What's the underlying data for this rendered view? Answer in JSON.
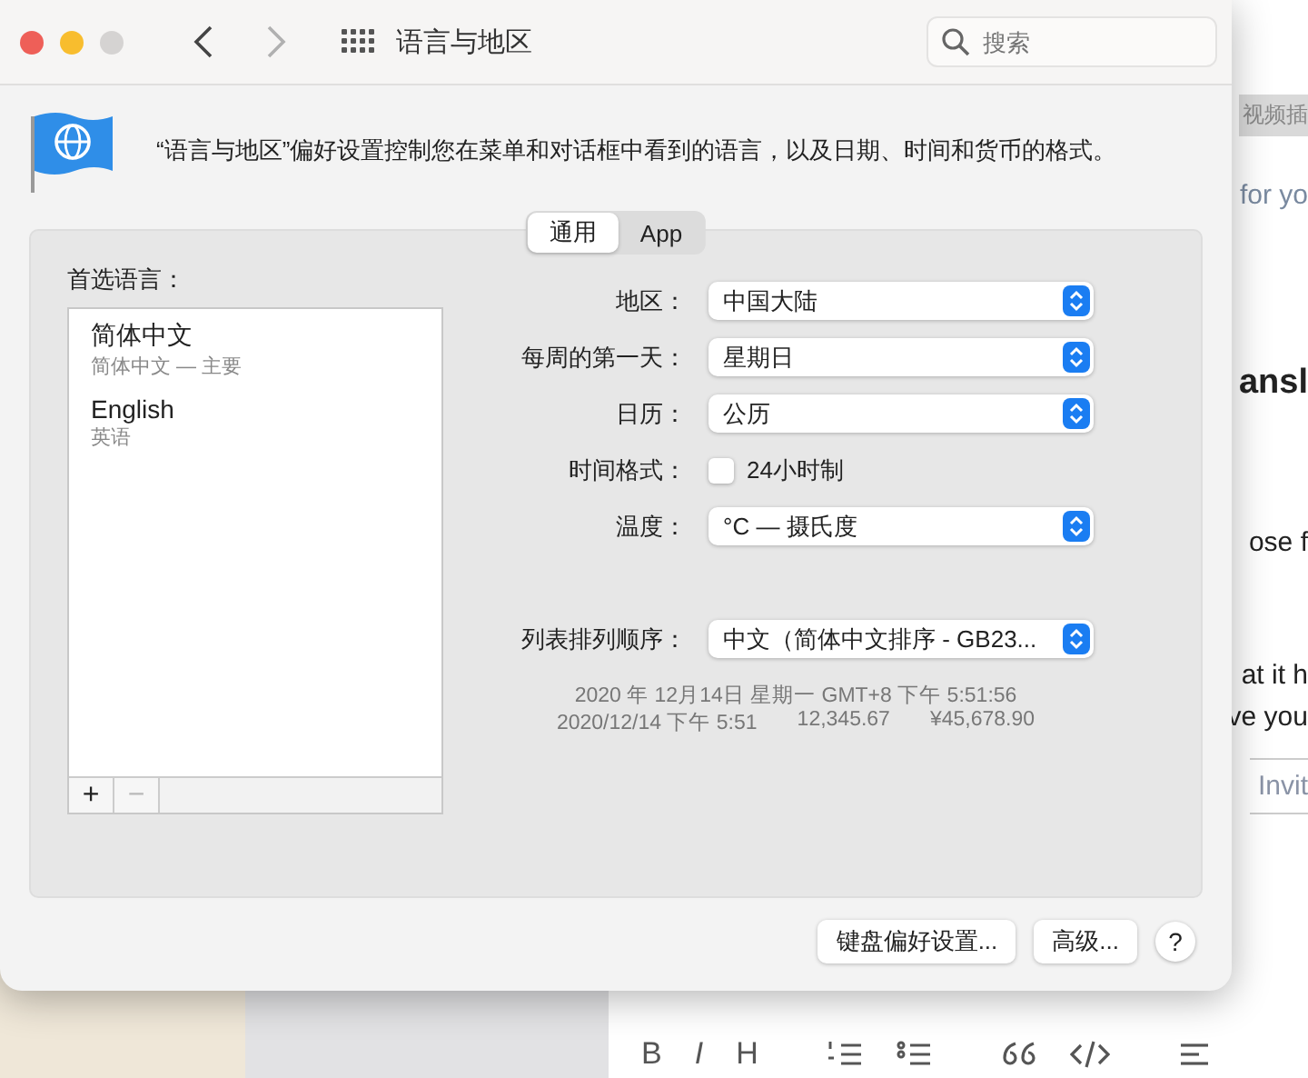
{
  "window": {
    "controls": [
      {
        "color": "#ee5f58"
      },
      {
        "color": "#f8bd2e"
      },
      {
        "color": "#d5d3d2"
      }
    ],
    "nav_buttons": [
      {
        "kind": "back",
        "disabled": false
      },
      {
        "kind": "forward",
        "disabled": true
      }
    ],
    "title": "语言与地区",
    "search": {
      "placeholder": "搜索"
    },
    "description": "“语言与地区”偏好设置控制您在菜单和对话框中看到的语言，以及日期、时间和货币的格式。",
    "tabs": [
      {
        "label": "通用",
        "selected": true
      },
      {
        "label": "App",
        "selected": false
      }
    ],
    "preferred_languages": {
      "label": "首选语言：",
      "items": [
        {
          "name": "简体中文",
          "detail": "简体中文 — 主要"
        },
        {
          "name": "English",
          "detail": "英语"
        }
      ],
      "buttons": [
        {
          "label": "+",
          "disabled": false
        },
        {
          "label": "−",
          "disabled": true
        }
      ]
    },
    "settings": [
      {
        "kind": "popup",
        "label": "地区：",
        "value": "中国大陆"
      },
      {
        "kind": "popup",
        "label": "每周的第一天：",
        "value": "星期日"
      },
      {
        "kind": "popup",
        "label": "日历：",
        "value": "公历"
      },
      {
        "kind": "checkbox",
        "label": "时间格式：",
        "option": "24小时制",
        "checked": false
      },
      {
        "kind": "popup",
        "label": "温度：",
        "value": "°C — 摄氏度"
      },
      {
        "kind": "popup",
        "label": "列表排列顺序：",
        "value": "中文（简体中文排序 - GB23..."
      }
    ],
    "samples": [
      [
        "2020 年 12月14日 星期一 GMT+8 下午 5:51:56"
      ],
      [
        "2020/12/14 下午 5:51",
        "12,345.67",
        "¥45,678.90"
      ]
    ],
    "buttons": [
      {
        "kind": "button",
        "label": "键盘偏好设置..."
      },
      {
        "kind": "button",
        "label": "高级..."
      },
      {
        "kind": "help",
        "label": "?"
      }
    ]
  },
  "background_app": {
    "fragments": [
      {
        "kind": "tab",
        "text": "视频插"
      },
      {
        "kind": "link",
        "text": "for yo"
      },
      {
        "kind": "heading",
        "text": "ansl"
      },
      {
        "kind": "text",
        "text": "ose f"
      },
      {
        "kind": "text",
        "text": "at it h"
      },
      {
        "kind": "text",
        "text": "ve you"
      },
      {
        "kind": "button",
        "text": "Invit"
      }
    ],
    "toolbar": [
      "B",
      "I",
      "H"
    ]
  }
}
